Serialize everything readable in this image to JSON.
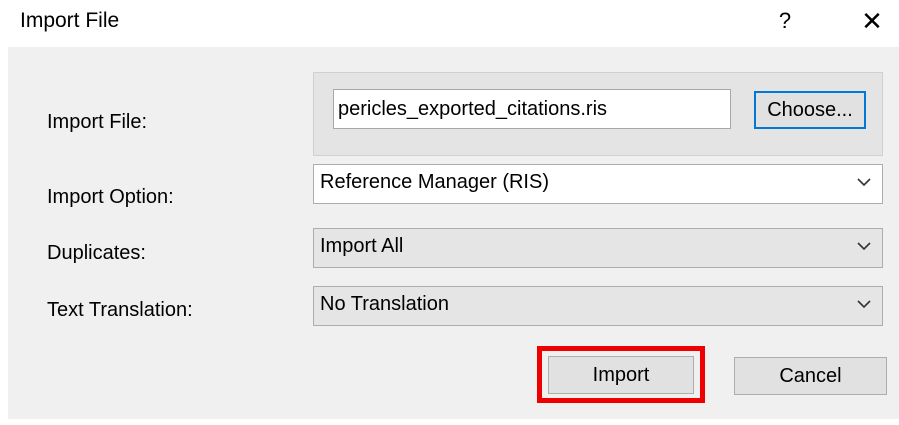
{
  "window": {
    "title": "Import File",
    "help_label": "?",
    "close_label": "✕"
  },
  "form": {
    "import_file": {
      "label": "Import File:",
      "value": "pericles_exported_citations.ris",
      "choose_label": "Choose..."
    },
    "import_option": {
      "label": "Import Option:",
      "selected": "Reference Manager (RIS)"
    },
    "duplicates": {
      "label": "Duplicates:",
      "selected": "Import All"
    },
    "text_translation": {
      "label": "Text Translation:",
      "selected": "No Translation"
    }
  },
  "buttons": {
    "import_label": "Import",
    "cancel_label": "Cancel"
  },
  "colors": {
    "focus_border": "#0078d7",
    "highlight": "#ee0000",
    "client_bg": "#f0f0f0"
  },
  "icons": {
    "help": "question-mark-icon",
    "close": "close-icon",
    "dropdown": "chevron-down-icon"
  }
}
